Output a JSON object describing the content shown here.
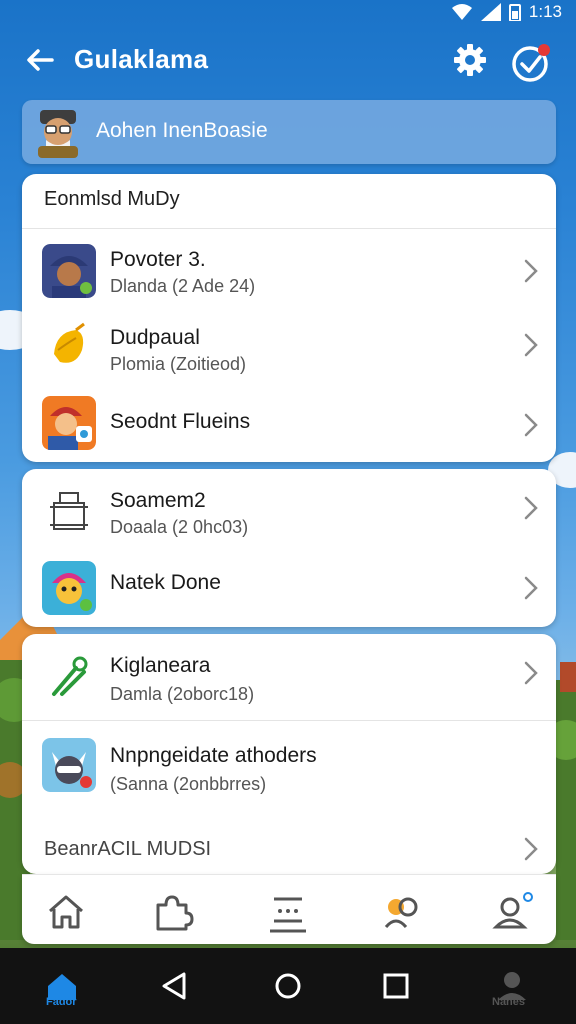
{
  "status_bar": {
    "time": "1:13"
  },
  "app_bar": {
    "title": "Gulaklama"
  },
  "profile": {
    "name": "Aohen InenBoasie"
  },
  "card1": {
    "header": "Eonmlsd MuDy",
    "items": [
      {
        "title": "Povoter 3.",
        "subtitle": "Dlanda (2 Ade 24)",
        "icon": "character-avatar-icon"
      },
      {
        "title": "Dudpaual",
        "subtitle": "Plomia (Zoitieod)",
        "icon": "lemon-icon"
      },
      {
        "title": "Seodnt Flueins",
        "subtitle": "",
        "icon": "firefighter-avatar-icon"
      }
    ]
  },
  "card2": {
    "items": [
      {
        "title": "Soamem2",
        "subtitle": "Doaala (2 0hc03)",
        "icon": "basket-icon"
      },
      {
        "title": "Natek Done",
        "subtitle": "",
        "icon": "cartoon-character-icon"
      }
    ]
  },
  "card3": {
    "items": [
      {
        "title": "Kiglaneara",
        "subtitle": "Damla (2oborc18)",
        "icon": "tools-icon"
      },
      {
        "title": "Nnpngeidate athoders",
        "subtitle": "(Sanna (2onbbrres)",
        "icon": "cat-character-icon"
      }
    ],
    "footer_label": "BeanrACIL MUDSI"
  },
  "tab_bar": {
    "tabs": [
      "home-icon",
      "puzzle-icon",
      "list-icon",
      "people-icon",
      "profile-icon"
    ]
  },
  "nav_bar": {
    "left_label": "Fador",
    "right_label": "Nanes"
  },
  "colors": {
    "accent_blue": "#1a73c8",
    "notification_red": "#e53935",
    "nav_active": "#1e88e5"
  }
}
